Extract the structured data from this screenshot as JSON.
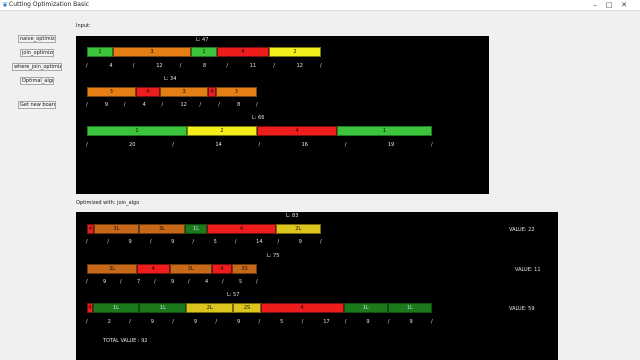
{
  "window": {
    "title": "Cutting Optimization Basic",
    "icon": "feather-icon",
    "controls": [
      "–",
      "□",
      "✕"
    ]
  },
  "buttons": [
    {
      "id": "naive",
      "label": "naive_optimize"
    },
    {
      "id": "join",
      "label": "join_optimize"
    },
    {
      "id": "where",
      "label": "where_join_optimize"
    },
    {
      "id": "optimal",
      "label": "Optimal_algo"
    },
    {
      "id": "new",
      "label": "Get new boards"
    }
  ],
  "input": {
    "heading": "Input:",
    "boards": [
      {
        "label": "L: 47",
        "segments": [
          {
            "text": "1",
            "color": "green",
            "w": 1
          },
          {
            "text": "3",
            "color": "orange",
            "w": 3
          },
          {
            "text": "1",
            "color": "green",
            "w": 1
          },
          {
            "text": "4",
            "color": "red",
            "w": 2
          },
          {
            "text": "2",
            "color": "yellow",
            "w": 2
          }
        ],
        "ticks": [
          "/",
          "4",
          "/",
          "12",
          "/",
          "8",
          "/",
          "11",
          "/",
          "12",
          "/"
        ]
      },
      {
        "label": "L: 34",
        "segments": [
          {
            "text": "3",
            "color": "orange",
            "w": 2
          },
          {
            "text": "4",
            "color": "red",
            "w": 1
          },
          {
            "text": "3",
            "color": "orange",
            "w": 2
          },
          {
            "text": "4",
            "color": "red",
            "w": 0.3
          },
          {
            "text": "3",
            "color": "orange",
            "w": 1.7
          }
        ],
        "ticks": [
          "/",
          "9",
          "/",
          "4",
          "/",
          "12",
          "/",
          "/",
          "8",
          "/"
        ]
      },
      {
        "label": "L: 66",
        "segments": [
          {
            "text": "1",
            "color": "green",
            "w": 2
          },
          {
            "text": "2",
            "color": "yellow",
            "w": 1.4
          },
          {
            "text": "4",
            "color": "red",
            "w": 1.6
          },
          {
            "text": "1",
            "color": "green",
            "w": 1.9
          }
        ],
        "ticks": [
          "/",
          "20",
          "/",
          "14",
          "/",
          "16",
          "/",
          "19",
          "/"
        ]
      }
    ]
  },
  "optimized": {
    "heading": "Optimized with: join_algo",
    "boards": [
      {
        "label": "L: 83",
        "value": "VALUE: 22",
        "segments": [
          {
            "text": "4",
            "color": "red",
            "w": 0.3
          },
          {
            "text": "3L",
            "color": "dorange",
            "w": 2
          },
          {
            "text": "3L",
            "color": "dorange",
            "w": 2
          },
          {
            "text": "1L",
            "color": "dgreen",
            "w": 1
          },
          {
            "text": "4",
            "color": "red",
            "w": 3
          },
          {
            "text": "2L",
            "color": "mustard",
            "w": 2
          }
        ],
        "ticks": [
          "/",
          "/",
          "9",
          "/",
          "9",
          "/",
          "5",
          "/",
          "14",
          "/",
          "9",
          "/"
        ]
      },
      {
        "label": "L: 75",
        "value": "VALUE: 11",
        "segments": [
          {
            "text": "3L",
            "color": "dorange",
            "w": 2
          },
          {
            "text": "4",
            "color": "red",
            "w": 1.3
          },
          {
            "text": "3L",
            "color": "dorange",
            "w": 1.7
          },
          {
            "text": "4",
            "color": "red",
            "w": 0.8
          },
          {
            "text": "3S",
            "color": "dorange",
            "w": 1
          }
        ],
        "ticks": [
          "/",
          "9",
          "/",
          "7",
          "/",
          "9",
          "/",
          "4",
          "/",
          "5",
          "/"
        ]
      },
      {
        "label": "L: 57",
        "value": "VALUE: 59",
        "segments": [
          {
            "text": "4",
            "color": "red",
            "w": 0.2
          },
          {
            "text": "1L",
            "color": "dgreen",
            "w": 1.7
          },
          {
            "text": "1L",
            "color": "dgreen",
            "w": 1.7
          },
          {
            "text": "2L",
            "color": "mustard",
            "w": 1.7
          },
          {
            "text": "2S",
            "color": "mustard",
            "w": 1
          },
          {
            "text": "4",
            "color": "red",
            "w": 3
          },
          {
            "text": "1L",
            "color": "dgreen",
            "w": 1.6
          },
          {
            "text": "1L",
            "color": "dgreen",
            "w": 1.6
          }
        ],
        "ticks": [
          "/",
          "2",
          "/",
          "9",
          "/",
          "9",
          "/",
          "9",
          "/",
          "5",
          "/",
          "17",
          "/",
          "9",
          "/",
          "9",
          "/"
        ]
      }
    ],
    "total": "TOTAL VALUE : 92"
  }
}
